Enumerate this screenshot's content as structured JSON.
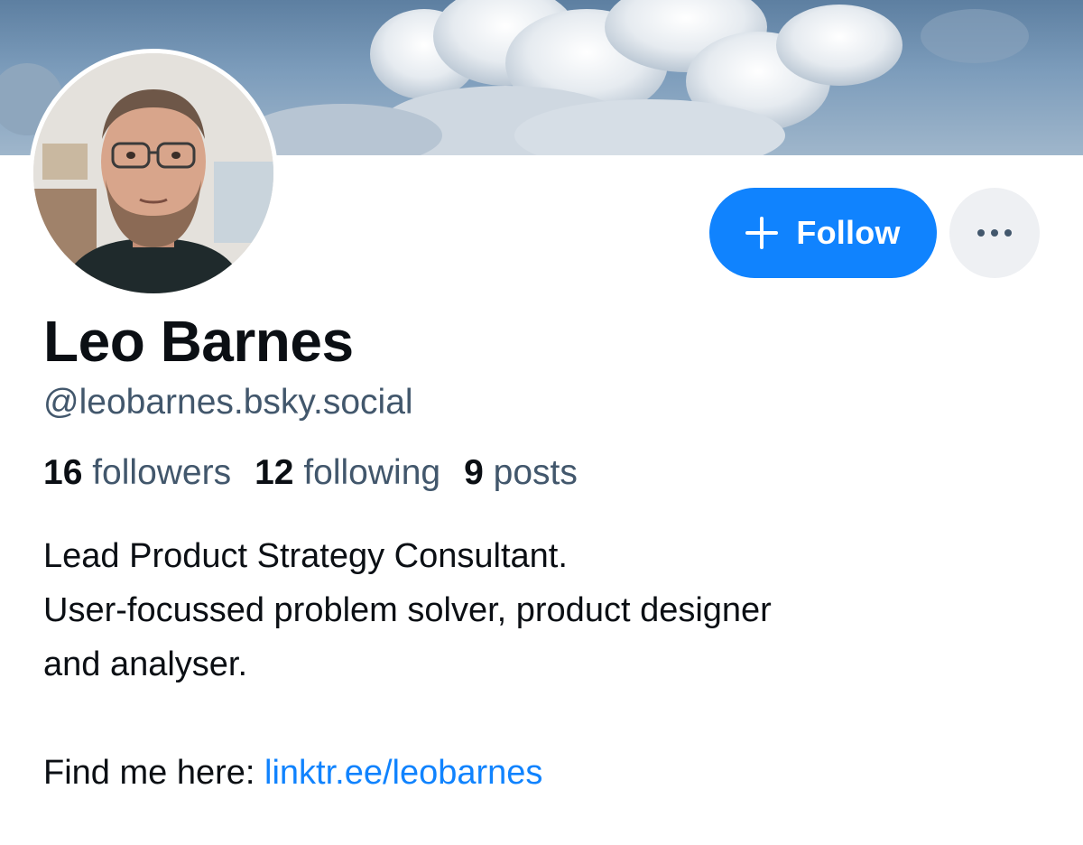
{
  "profile": {
    "display_name": "Leo Barnes",
    "handle": "@leobarnes.bsky.social",
    "stats": {
      "followers_count": "16",
      "followers_label": "followers",
      "following_count": "12",
      "following_label": "following",
      "posts_count": "9",
      "posts_label": "posts"
    },
    "bio": {
      "line1": "Lead Product Strategy Consultant.",
      "line2": "User-focussed problem solver, product designer",
      "line3": "and analyser.",
      "find_prefix": "Find me here: ",
      "link_text": "linktr.ee/leobarnes"
    }
  },
  "actions": {
    "follow_label": "Follow",
    "follow_icon": "plus-icon",
    "more_icon": "ellipsis-icon"
  },
  "colors": {
    "accent": "#1083fe",
    "secondary_text": "#42576c",
    "primary_text": "#0b0f14",
    "more_button_bg": "#eef0f3"
  }
}
